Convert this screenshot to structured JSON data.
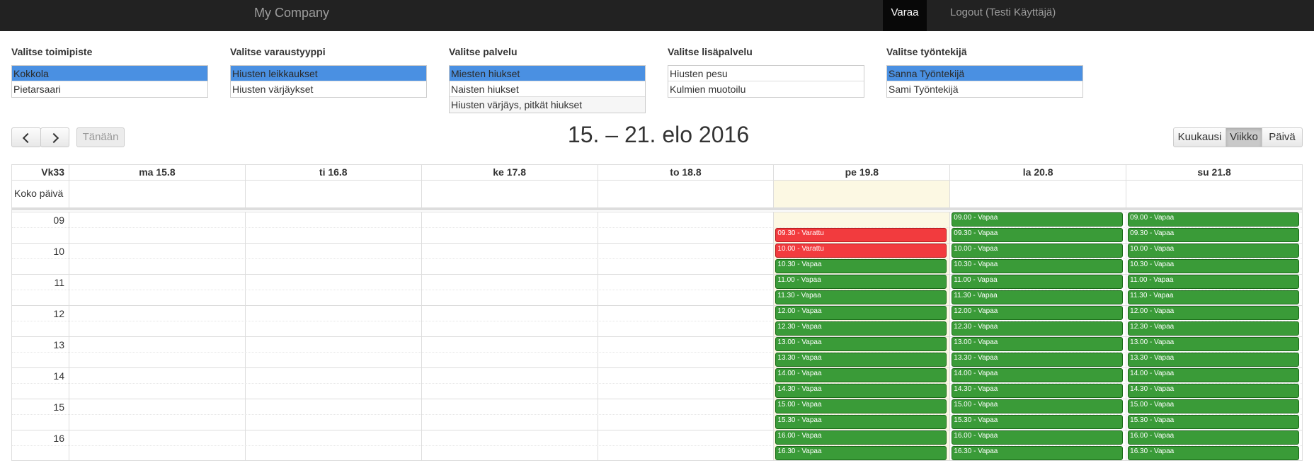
{
  "navbar": {
    "brand": "My Company",
    "active_item": "Varaa",
    "logout": "Logout (Testi Käyttäjä)"
  },
  "filters": [
    {
      "label": "Valitse toimipiste",
      "options": [
        {
          "text": "Kokkola",
          "selected": true
        },
        {
          "text": "Pietarsaari",
          "selected": false
        }
      ]
    },
    {
      "label": "Valitse varaustyyppi",
      "options": [
        {
          "text": "Hiusten leikkaukset",
          "selected": true
        },
        {
          "text": "Hiusten värjäykset",
          "selected": false
        }
      ]
    },
    {
      "label": "Valitse palvelu",
      "options": [
        {
          "text": "Miesten hiukset",
          "selected": true
        },
        {
          "text": "Naisten hiukset",
          "selected": false
        },
        {
          "text": "Hiusten värjäys, pitkät hiukset",
          "selected": false
        }
      ]
    },
    {
      "label": "Valitse lisäpalvelu",
      "options": [
        {
          "text": "Hiusten pesu",
          "selected": false
        },
        {
          "text": "Kulmien muotoilu",
          "selected": false
        }
      ]
    },
    {
      "label": "Valitse työntekijä",
      "options": [
        {
          "text": "Sanna Työntekijä",
          "selected": true
        },
        {
          "text": "Sami Työntekijä",
          "selected": false
        }
      ]
    }
  ],
  "toolbar": {
    "today": "Tänään",
    "title": "15. – 21. elo 2016",
    "views": [
      {
        "label": "Kuukausi",
        "active": false
      },
      {
        "label": "Viikko",
        "active": true
      },
      {
        "label": "Päivä",
        "active": false
      }
    ]
  },
  "calendar": {
    "week_label": "Vk33",
    "allday_label": "Koko päivä",
    "days": [
      {
        "label": "ma 15.8",
        "today": false
      },
      {
        "label": "ti 16.8",
        "today": false
      },
      {
        "label": "ke 17.8",
        "today": false
      },
      {
        "label": "to 18.8",
        "today": false
      },
      {
        "label": "pe 19.8",
        "today": true
      },
      {
        "label": "la 20.8",
        "today": false
      },
      {
        "label": "su 21.8",
        "today": false
      }
    ],
    "hours": [
      "09",
      "10",
      "11",
      "12",
      "13",
      "14",
      "15",
      "16"
    ],
    "slots": [
      "09.00",
      "09.30",
      "10.00",
      "10.30",
      "11.00",
      "11.30",
      "12.00",
      "12.30",
      "13.00",
      "13.30",
      "14.00",
      "14.30",
      "15.00",
      "15.30",
      "16.00",
      "16.30"
    ],
    "events": [
      {
        "day": 4,
        "slot": 1,
        "text": "09.30 - Varattu",
        "status": "booked"
      },
      {
        "day": 4,
        "slot": 2,
        "text": "10.00 - Varattu",
        "status": "booked"
      },
      {
        "day": 4,
        "slot": 3,
        "text": "10.30 - Vapaa",
        "status": "free"
      },
      {
        "day": 4,
        "slot": 4,
        "text": "11.00 - Vapaa",
        "status": "free"
      },
      {
        "day": 4,
        "slot": 5,
        "text": "11.30 - Vapaa",
        "status": "free"
      },
      {
        "day": 4,
        "slot": 6,
        "text": "12.00 - Vapaa",
        "status": "free"
      },
      {
        "day": 4,
        "slot": 7,
        "text": "12.30 - Vapaa",
        "status": "free"
      },
      {
        "day": 4,
        "slot": 8,
        "text": "13.00 - Vapaa",
        "status": "free"
      },
      {
        "day": 4,
        "slot": 9,
        "text": "13.30 - Vapaa",
        "status": "free"
      },
      {
        "day": 4,
        "slot": 10,
        "text": "14.00 - Vapaa",
        "status": "free"
      },
      {
        "day": 4,
        "slot": 11,
        "text": "14.30 - Vapaa",
        "status": "free"
      },
      {
        "day": 4,
        "slot": 12,
        "text": "15.00 - Vapaa",
        "status": "free"
      },
      {
        "day": 4,
        "slot": 13,
        "text": "15.30 - Vapaa",
        "status": "free"
      },
      {
        "day": 4,
        "slot": 14,
        "text": "16.00 - Vapaa",
        "status": "free"
      },
      {
        "day": 4,
        "slot": 15,
        "text": "16.30 - Vapaa",
        "status": "free"
      },
      {
        "day": 5,
        "slot": 0,
        "text": "09.00 - Vapaa",
        "status": "free"
      },
      {
        "day": 5,
        "slot": 1,
        "text": "09.30 - Vapaa",
        "status": "free"
      },
      {
        "day": 5,
        "slot": 2,
        "text": "10.00 - Vapaa",
        "status": "free"
      },
      {
        "day": 5,
        "slot": 3,
        "text": "10.30 - Vapaa",
        "status": "free"
      },
      {
        "day": 5,
        "slot": 4,
        "text": "11.00 - Vapaa",
        "status": "free"
      },
      {
        "day": 5,
        "slot": 5,
        "text": "11.30 - Vapaa",
        "status": "free"
      },
      {
        "day": 5,
        "slot": 6,
        "text": "12.00 - Vapaa",
        "status": "free"
      },
      {
        "day": 5,
        "slot": 7,
        "text": "12.30 - Vapaa",
        "status": "free"
      },
      {
        "day": 5,
        "slot": 8,
        "text": "13.00 - Vapaa",
        "status": "free"
      },
      {
        "day": 5,
        "slot": 9,
        "text": "13.30 - Vapaa",
        "status": "free"
      },
      {
        "day": 5,
        "slot": 10,
        "text": "14.00 - Vapaa",
        "status": "free"
      },
      {
        "day": 5,
        "slot": 11,
        "text": "14.30 - Vapaa",
        "status": "free"
      },
      {
        "day": 5,
        "slot": 12,
        "text": "15.00 - Vapaa",
        "status": "free"
      },
      {
        "day": 5,
        "slot": 13,
        "text": "15.30 - Vapaa",
        "status": "free"
      },
      {
        "day": 5,
        "slot": 14,
        "text": "16.00 - Vapaa",
        "status": "free"
      },
      {
        "day": 5,
        "slot": 15,
        "text": "16.30 - Vapaa",
        "status": "free"
      },
      {
        "day": 6,
        "slot": 0,
        "text": "09.00 - Vapaa",
        "status": "free"
      },
      {
        "day": 6,
        "slot": 1,
        "text": "09.30 - Vapaa",
        "status": "free"
      },
      {
        "day": 6,
        "slot": 2,
        "text": "10.00 - Vapaa",
        "status": "free"
      },
      {
        "day": 6,
        "slot": 3,
        "text": "10.30 - Vapaa",
        "status": "free"
      },
      {
        "day": 6,
        "slot": 4,
        "text": "11.00 - Vapaa",
        "status": "free"
      },
      {
        "day": 6,
        "slot": 5,
        "text": "11.30 - Vapaa",
        "status": "free"
      },
      {
        "day": 6,
        "slot": 6,
        "text": "12.00 - Vapaa",
        "status": "free"
      },
      {
        "day": 6,
        "slot": 7,
        "text": "12.30 - Vapaa",
        "status": "free"
      },
      {
        "day": 6,
        "slot": 8,
        "text": "13.00 - Vapaa",
        "status": "free"
      },
      {
        "day": 6,
        "slot": 9,
        "text": "13.30 - Vapaa",
        "status": "free"
      },
      {
        "day": 6,
        "slot": 10,
        "text": "14.00 - Vapaa",
        "status": "free"
      },
      {
        "day": 6,
        "slot": 11,
        "text": "14.30 - Vapaa",
        "status": "free"
      },
      {
        "day": 6,
        "slot": 12,
        "text": "15.00 - Vapaa",
        "status": "free"
      },
      {
        "day": 6,
        "slot": 13,
        "text": "15.30 - Vapaa",
        "status": "free"
      },
      {
        "day": 6,
        "slot": 14,
        "text": "16.00 - Vapaa",
        "status": "free"
      },
      {
        "day": 6,
        "slot": 15,
        "text": "16.30 - Vapaa",
        "status": "free"
      }
    ]
  },
  "colors": {
    "navbar": "#222222",
    "selected": "#4a90e2",
    "free": "#3a9b38",
    "booked": "#f23b3e",
    "today": "#fcf8e3"
  }
}
